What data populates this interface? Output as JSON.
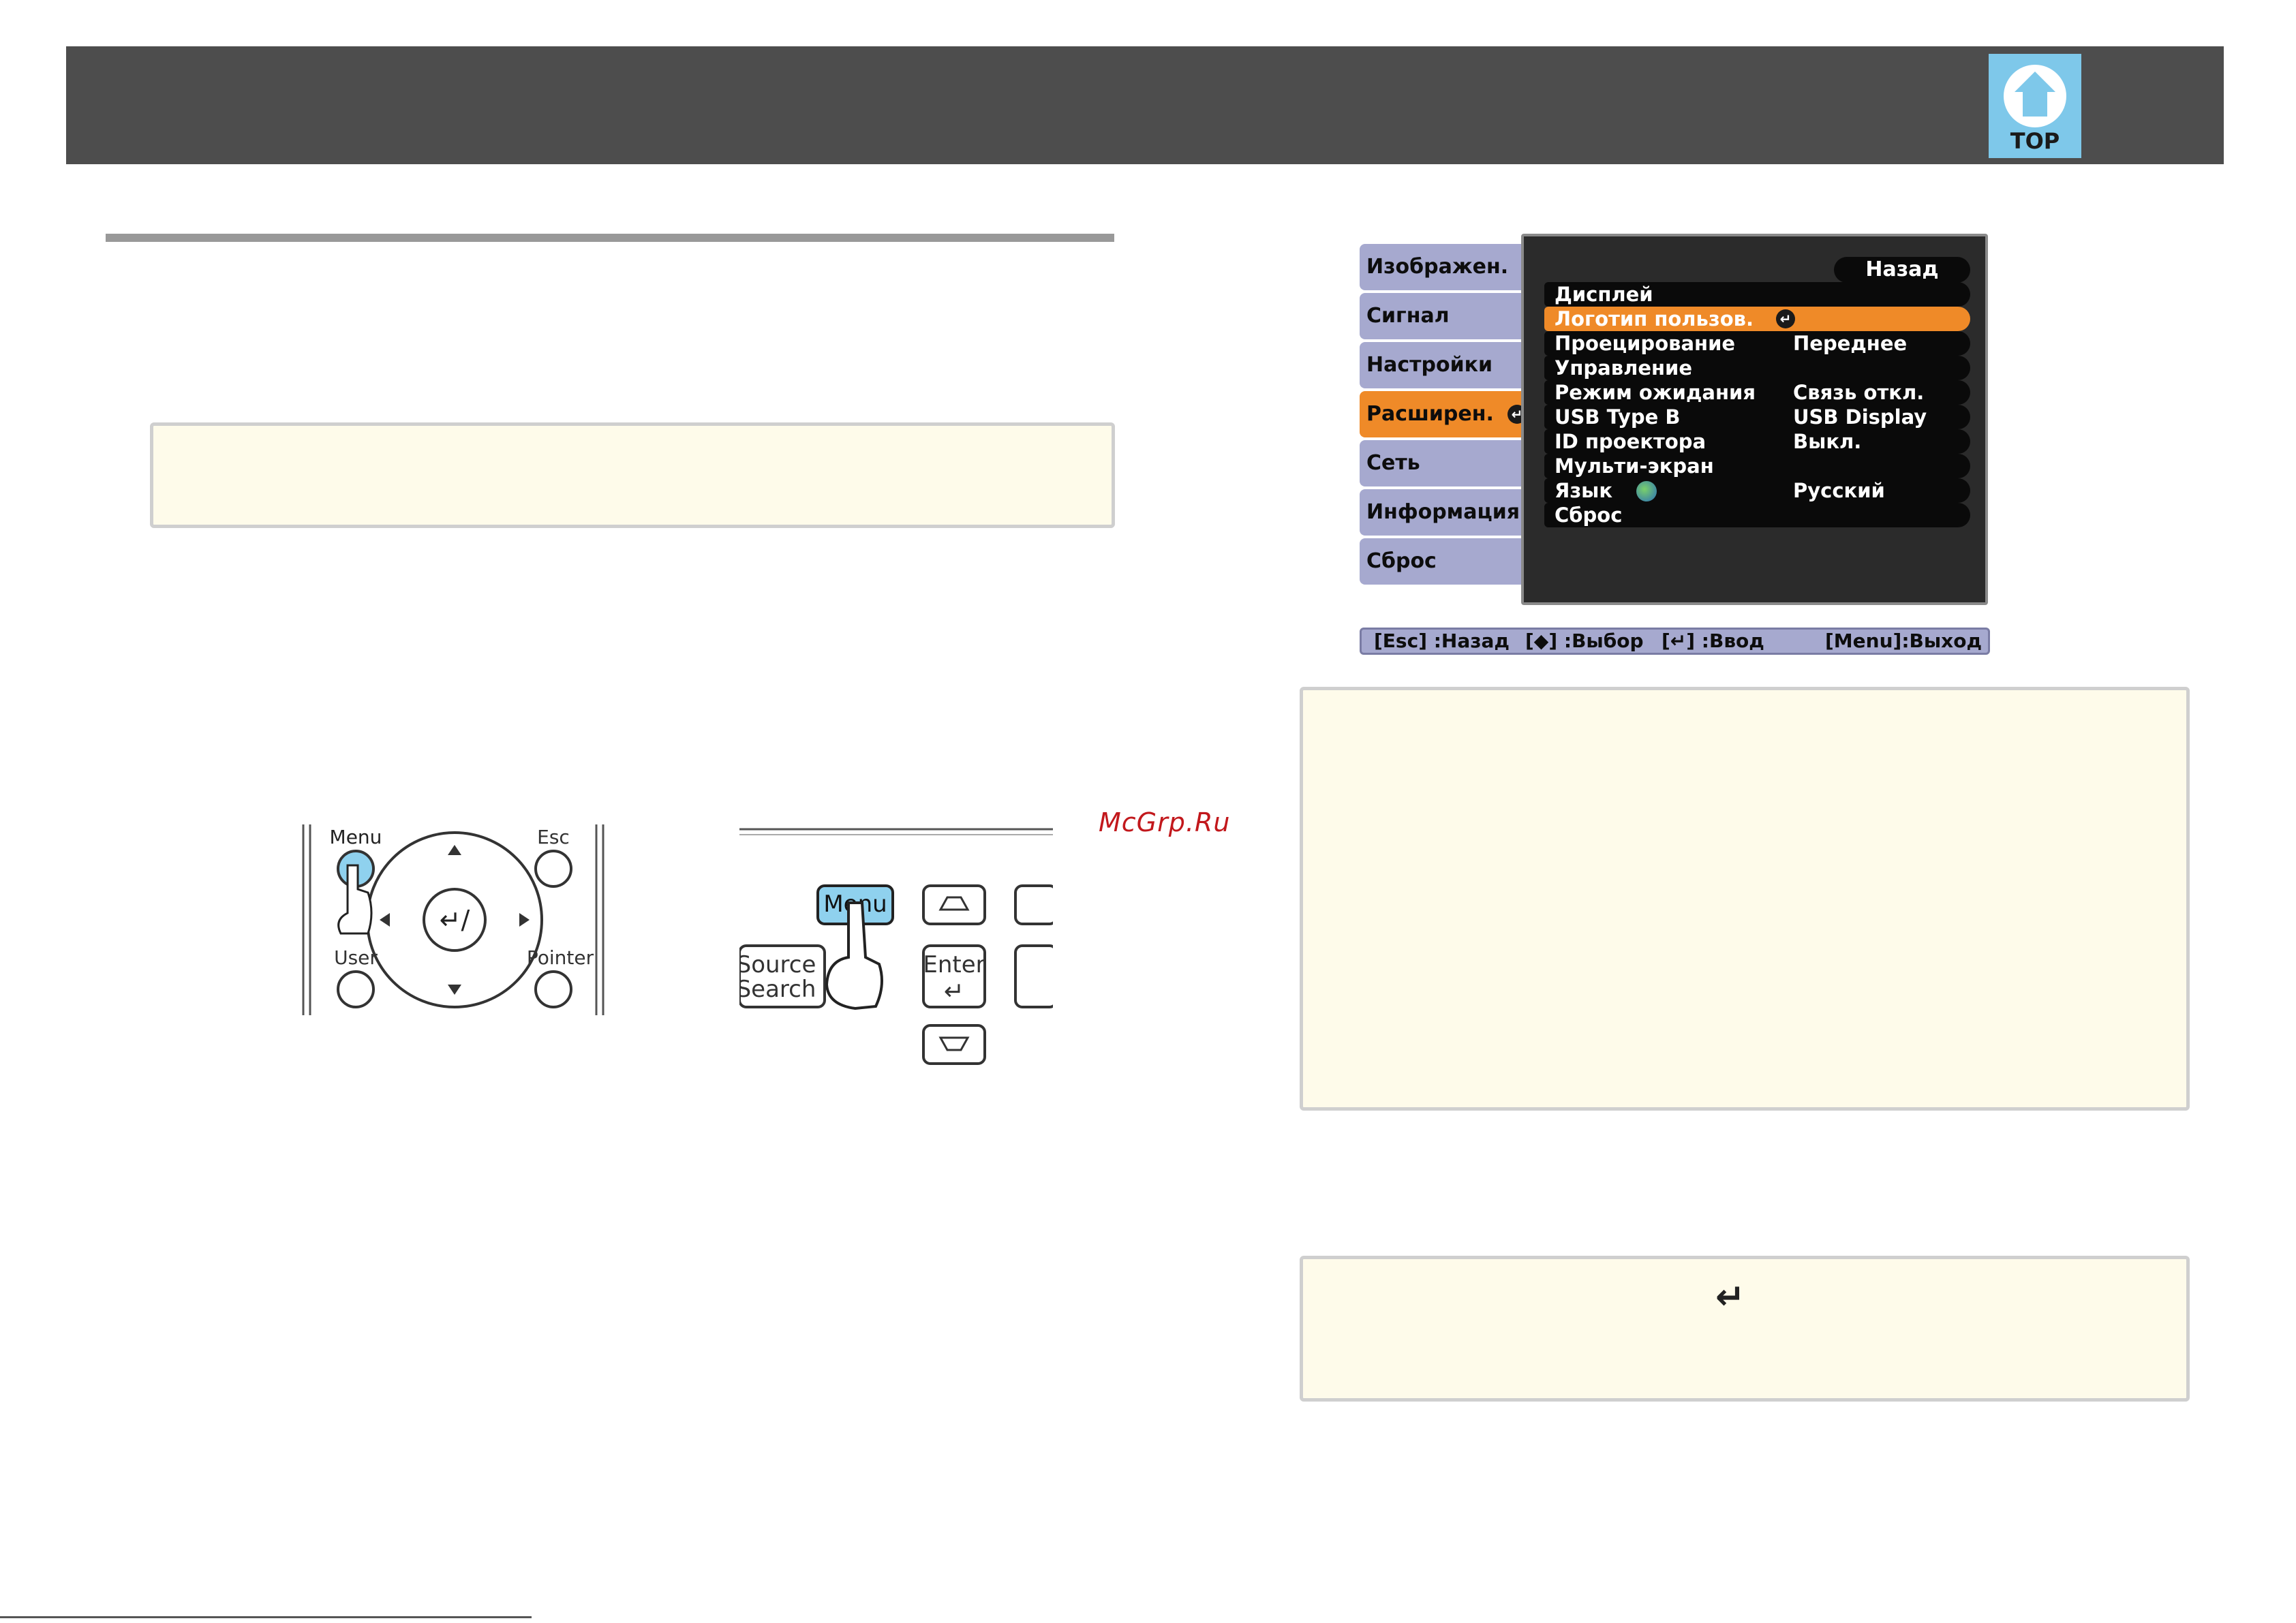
{
  "header": {
    "logo_label": "TOP"
  },
  "menu_screenshot": {
    "categories": [
      {
        "label": "Изображен."
      },
      {
        "label": "Сигнал"
      },
      {
        "label": "Настройки"
      },
      {
        "label": "Расширен."
      },
      {
        "label": "Сеть"
      },
      {
        "label": "Информация"
      },
      {
        "label": "Сброс"
      }
    ],
    "active_category": "Расширен.",
    "back_label": "Назад",
    "rows": [
      {
        "label": "Дисплей",
        "value": ""
      },
      {
        "label": "Логотип пользов.",
        "value": ""
      },
      {
        "label": "Проецирование",
        "value": "Переднее"
      },
      {
        "label": "Управление",
        "value": ""
      },
      {
        "label": "Режим ожидания",
        "value": "Связь откл."
      },
      {
        "label": "USB Type B",
        "value": "USB Display"
      },
      {
        "label": "ID проектора",
        "value": "Выкл."
      },
      {
        "label": "Мульти-экран",
        "value": ""
      },
      {
        "label": "Язык",
        "value": "Русский"
      },
      {
        "label": "Сброс",
        "value": ""
      }
    ],
    "highlighted_row": "Логотип пользов.",
    "hints": {
      "esc": "[Esc] :Назад",
      "select": "[◆] :Выбор",
      "enter": "[↵] :Ввод",
      "menu": "[Menu]:Выход"
    },
    "colors": {
      "highlight": "#ef8a28",
      "category_bg": "#a6a9cf",
      "panel_bg": "#2b2b2b"
    }
  },
  "remote_illustration": {
    "menu_label": "Menu",
    "esc_label": "Esc",
    "user_label": "User",
    "pointer_label": "Pointer"
  },
  "panel_illustration": {
    "menu_label": "Menu",
    "source_label_1": "Source",
    "source_label_2": "Search",
    "enter_label": "Enter"
  },
  "watermark": "McGrp.Ru"
}
